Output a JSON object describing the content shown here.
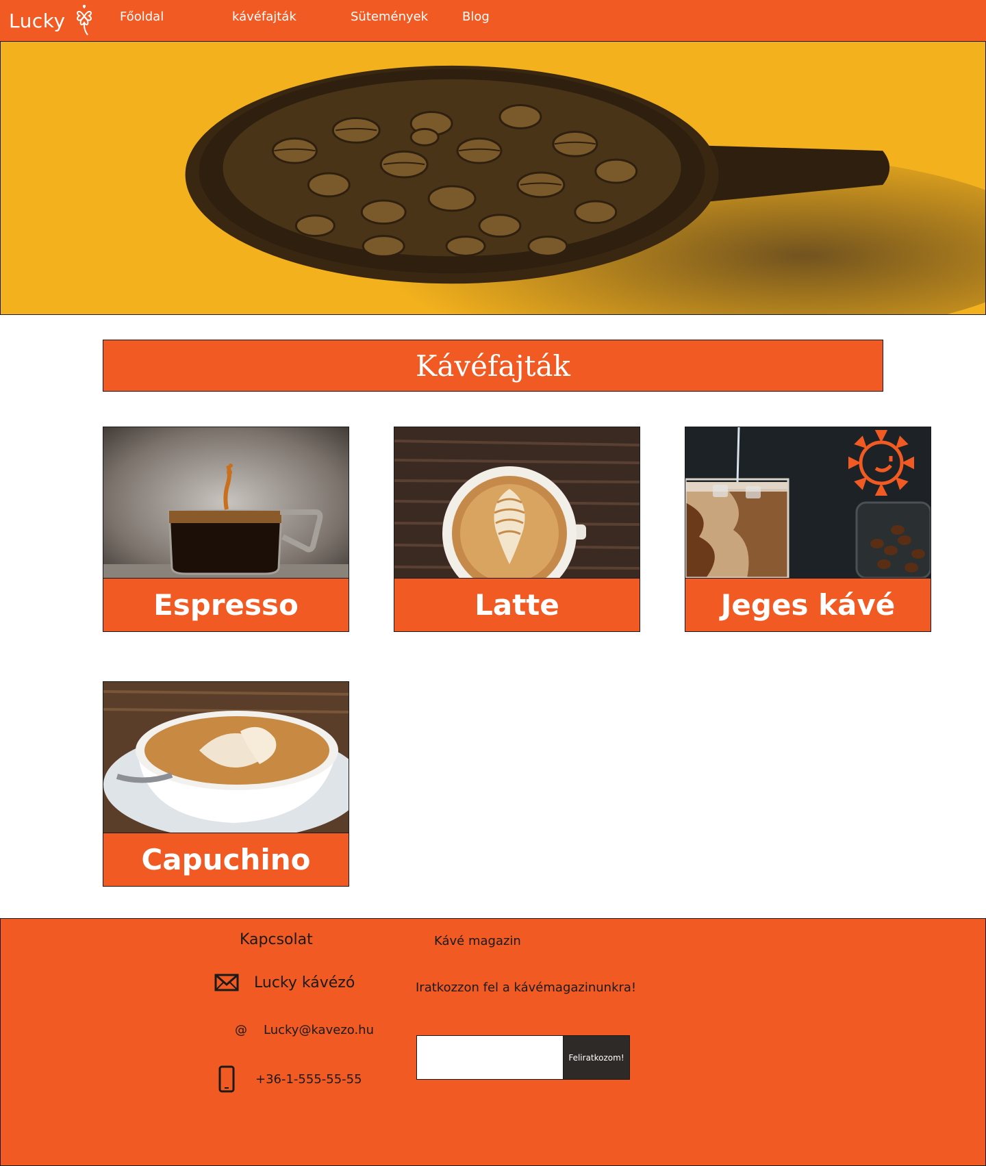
{
  "brand": {
    "name": "Lucky"
  },
  "nav": {
    "items": [
      {
        "label": "Főoldal"
      },
      {
        "label": "kávéfajták"
      },
      {
        "label": "Sütemények"
      },
      {
        "label": "Blog"
      }
    ]
  },
  "section_title": "Kávéfajták",
  "products": [
    {
      "name": "Espresso",
      "image": "espresso-photo"
    },
    {
      "name": "Latte",
      "image": "latte-photo"
    },
    {
      "name": "Jeges kávé",
      "image": "iced-coffee-photo"
    },
    {
      "name": "Capuchino",
      "image": "cappuccino-photo"
    }
  ],
  "footer": {
    "contact_heading": "Kapcsolat",
    "contact_name": "Lucky kávézó",
    "email": "Lucky@kavezo.hu",
    "phone": "+36-1-555-55-55",
    "magazine_heading": "Kávé magazin",
    "magazine_invite": "Iratkozzon fel a kávémagazinunkra!",
    "subscribe_input_value": "",
    "subscribe_button": "Feliratkozom!"
  },
  "colors": {
    "primary_orange": "#f15a22",
    "hero_yellow": "#f3b11d",
    "dark_brown": "#2e1f0f",
    "button_dark": "#2e2a28",
    "text_white": "#ffffff"
  }
}
